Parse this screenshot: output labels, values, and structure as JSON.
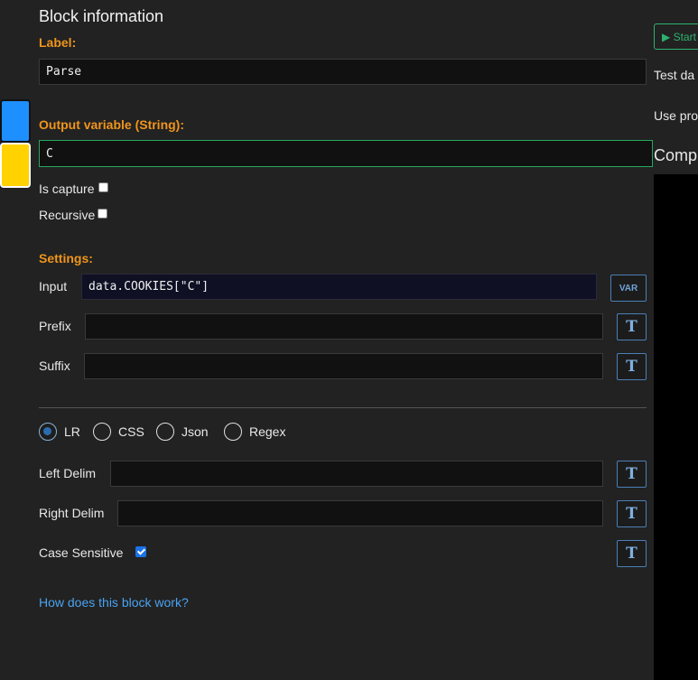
{
  "header": {
    "title": "Block information"
  },
  "label_section": {
    "heading": "Label:",
    "value": "Parse"
  },
  "output_section": {
    "heading": "Output variable (String):",
    "value": "C"
  },
  "options": {
    "is_capture": {
      "label": "Is capture",
      "checked": false
    },
    "recursive": {
      "label": "Recursive",
      "checked": false
    }
  },
  "settings": {
    "heading": "Settings:",
    "input": {
      "label": "Input",
      "value": "data.COOKIES[\"C\"]",
      "button": "VAR"
    },
    "prefix": {
      "label": "Prefix",
      "value": "",
      "button": "T"
    },
    "suffix": {
      "label": "Suffix",
      "value": "",
      "button": "T"
    }
  },
  "mode": {
    "options": [
      "LR",
      "CSS",
      "Json",
      "Regex"
    ],
    "selected": "LR"
  },
  "lr": {
    "left_delim": {
      "label": "Left Delim",
      "value": "",
      "button": "T"
    },
    "right_delim": {
      "label": "Right Delim",
      "value": "",
      "button": "T"
    },
    "case_sensitive": {
      "label": "Case Sensitive",
      "checked": true,
      "button": "T"
    }
  },
  "help_link": "How does this block work?",
  "right_panel": {
    "start_button": "▶ Start",
    "test_data": "Test da",
    "use_proxy": "Use pro",
    "complete": "Comp"
  },
  "colors": {
    "swatch_blue": "#1e8fff",
    "swatch_yellow": "#ffd200",
    "accent_orange": "#f0951c",
    "link_blue": "#4aa3f0"
  }
}
